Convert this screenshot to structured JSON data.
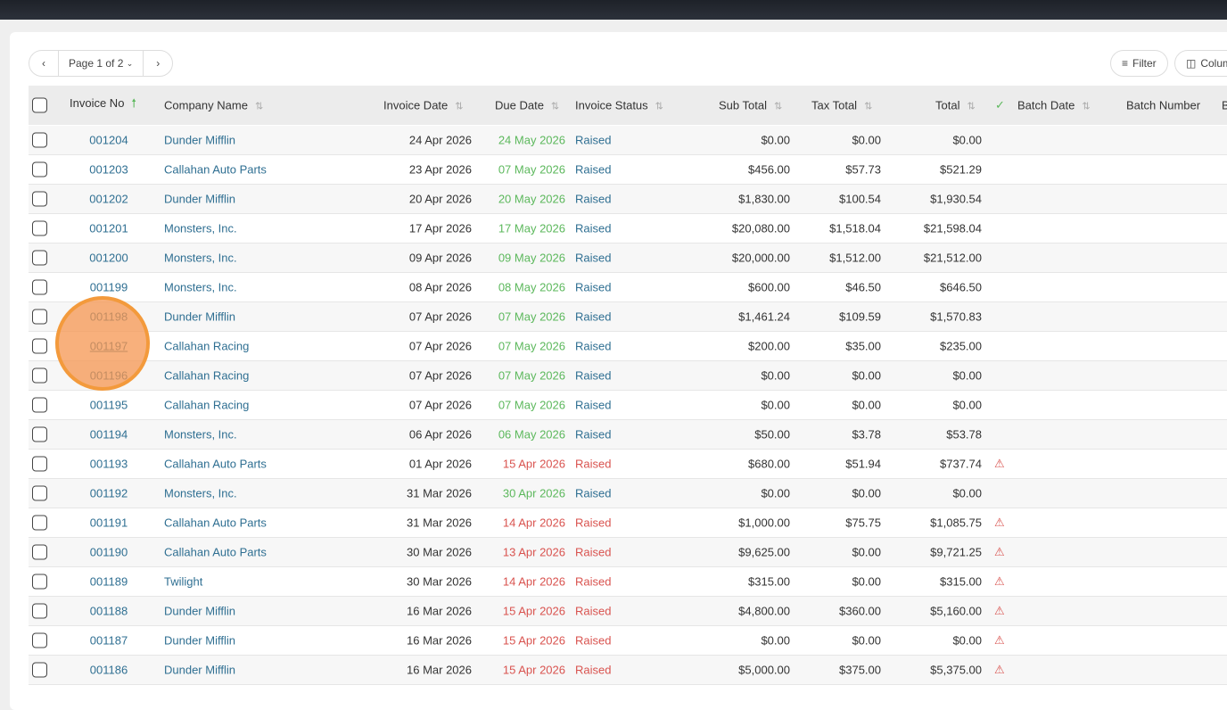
{
  "pager": {
    "prev": "‹",
    "label": "Page 1 of 2",
    "caret": "⌄",
    "next": "›"
  },
  "toolbar": {
    "filter": "Filter",
    "columns": "Colum"
  },
  "headers": {
    "invoice_no": "Invoice No",
    "company": "Company Name",
    "invoice_date": "Invoice Date",
    "due_date": "Due Date",
    "status": "Invoice Status",
    "sub_total": "Sub Total",
    "tax_total": "Tax Total",
    "total": "Total",
    "batch_date": "Batch Date",
    "batch_number": "Batch Number",
    "next_col": "B"
  },
  "colors": {
    "link": "#2f6f92",
    "green": "#5cb85c",
    "red": "#d9534f",
    "highlight": "#f39a3c"
  },
  "rows": [
    {
      "no": "001204",
      "company": "Dunder Mifflin",
      "inv": "24 Apr 2026",
      "due": "24 May 2026",
      "due_state": "green",
      "status": "Raised",
      "sub": "$0.00",
      "tax": "$0.00",
      "total": "$0.00",
      "warn": false
    },
    {
      "no": "001203",
      "company": "Callahan Auto Parts",
      "inv": "23 Apr 2026",
      "due": "07 May 2026",
      "due_state": "green",
      "status": "Raised",
      "sub": "$456.00",
      "tax": "$57.73",
      "total": "$521.29",
      "warn": false
    },
    {
      "no": "001202",
      "company": "Dunder Mifflin",
      "inv": "20 Apr 2026",
      "due": "20 May 2026",
      "due_state": "green",
      "status": "Raised",
      "sub": "$1,830.00",
      "tax": "$100.54",
      "total": "$1,930.54",
      "warn": false
    },
    {
      "no": "001201",
      "company": "Monsters, Inc.",
      "inv": "17 Apr 2026",
      "due": "17 May 2026",
      "due_state": "green",
      "status": "Raised",
      "sub": "$20,080.00",
      "tax": "$1,518.04",
      "total": "$21,598.04",
      "warn": false
    },
    {
      "no": "001200",
      "company": "Monsters, Inc.",
      "inv": "09 Apr 2026",
      "due": "09 May 2026",
      "due_state": "green",
      "status": "Raised",
      "sub": "$20,000.00",
      "tax": "$1,512.00",
      "total": "$21,512.00",
      "warn": false
    },
    {
      "no": "001199",
      "company": "Monsters, Inc.",
      "inv": "08 Apr 2026",
      "due": "08 May 2026",
      "due_state": "green",
      "status": "Raised",
      "sub": "$600.00",
      "tax": "$46.50",
      "total": "$646.50",
      "warn": false
    },
    {
      "no": "001198",
      "company": "Dunder Mifflin",
      "inv": "07 Apr 2026",
      "due": "07 May 2026",
      "due_state": "green",
      "status": "Raised",
      "sub": "$1,461.24",
      "tax": "$109.59",
      "total": "$1,570.83",
      "warn": false
    },
    {
      "no": "001197",
      "company": "Callahan Racing",
      "inv": "07 Apr 2026",
      "due": "07 May 2026",
      "due_state": "green",
      "status": "Raised",
      "sub": "$200.00",
      "tax": "$35.00",
      "total": "$235.00",
      "warn": false
    },
    {
      "no": "001196",
      "company": "Callahan Racing",
      "inv": "07 Apr 2026",
      "due": "07 May 2026",
      "due_state": "green",
      "status": "Raised",
      "sub": "$0.00",
      "tax": "$0.00",
      "total": "$0.00",
      "warn": false
    },
    {
      "no": "001195",
      "company": "Callahan Racing",
      "inv": "07 Apr 2026",
      "due": "07 May 2026",
      "due_state": "green",
      "status": "Raised",
      "sub": "$0.00",
      "tax": "$0.00",
      "total": "$0.00",
      "warn": false
    },
    {
      "no": "001194",
      "company": "Monsters, Inc.",
      "inv": "06 Apr 2026",
      "due": "06 May 2026",
      "due_state": "green",
      "status": "Raised",
      "sub": "$50.00",
      "tax": "$3.78",
      "total": "$53.78",
      "warn": false
    },
    {
      "no": "001193",
      "company": "Callahan Auto Parts",
      "inv": "01 Apr 2026",
      "due": "15 Apr 2026",
      "due_state": "red",
      "status": "Raised",
      "sub": "$680.00",
      "tax": "$51.94",
      "total": "$737.74",
      "warn": true
    },
    {
      "no": "001192",
      "company": "Monsters, Inc.",
      "inv": "31 Mar 2026",
      "due": "30 Apr 2026",
      "due_state": "green",
      "status": "Raised",
      "sub": "$0.00",
      "tax": "$0.00",
      "total": "$0.00",
      "warn": false
    },
    {
      "no": "001191",
      "company": "Callahan Auto Parts",
      "inv": "31 Mar 2026",
      "due": "14 Apr 2026",
      "due_state": "red",
      "status": "Raised",
      "sub": "$1,000.00",
      "tax": "$75.75",
      "total": "$1,085.75",
      "warn": true
    },
    {
      "no": "001190",
      "company": "Callahan Auto Parts",
      "inv": "30 Mar 2026",
      "due": "13 Apr 2026",
      "due_state": "red",
      "status": "Raised",
      "sub": "$9,625.00",
      "tax": "$0.00",
      "total": "$9,721.25",
      "warn": true
    },
    {
      "no": "001189",
      "company": "Twilight",
      "inv": "30 Mar 2026",
      "due": "14 Apr 2026",
      "due_state": "red",
      "status": "Raised",
      "sub": "$315.00",
      "tax": "$0.00",
      "total": "$315.00",
      "warn": true
    },
    {
      "no": "001188",
      "company": "Dunder Mifflin",
      "inv": "16 Mar 2026",
      "due": "15 Apr 2026",
      "due_state": "red",
      "status": "Raised",
      "sub": "$4,800.00",
      "tax": "$360.00",
      "total": "$5,160.00",
      "warn": true
    },
    {
      "no": "001187",
      "company": "Dunder Mifflin",
      "inv": "16 Mar 2026",
      "due": "15 Apr 2026",
      "due_state": "red",
      "status": "Raised",
      "sub": "$0.00",
      "tax": "$0.00",
      "total": "$0.00",
      "warn": true
    },
    {
      "no": "001186",
      "company": "Dunder Mifflin",
      "inv": "16 Mar 2026",
      "due": "15 Apr 2026",
      "due_state": "red",
      "status": "Raised",
      "sub": "$5,000.00",
      "tax": "$375.00",
      "total": "$5,375.00",
      "warn": true
    }
  ]
}
